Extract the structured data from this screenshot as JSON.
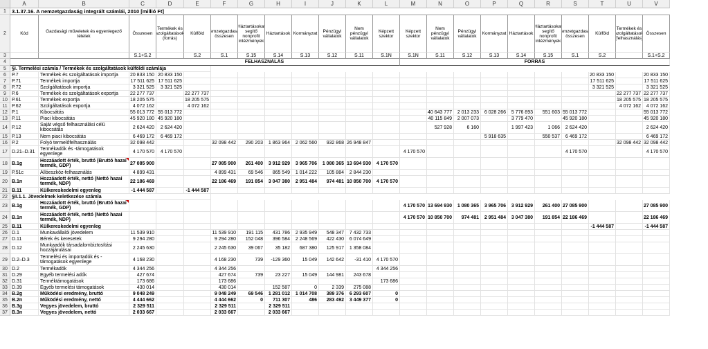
{
  "title": "3.1.37.16. A nemzetgazdaság integrált számlái, 2010 [millió Ft]",
  "columns": [
    "A",
    "B",
    "C",
    "D",
    "E",
    "F",
    "G",
    "H",
    "I",
    "J",
    "K",
    "L",
    "M",
    "N",
    "O",
    "P",
    "Q",
    "R",
    "S",
    "T",
    "U",
    "V"
  ],
  "header_row2": [
    "Kód",
    "Gazdasági műveletek és egyenlegező tételek",
    "Összesen",
    "Termékek és szolgáltatások (forrás)",
    "Külföld",
    "Nemzetgazdaság összesen",
    "Háztartásokat segítő nonprofit intézmények",
    "Háztartások",
    "Kormányzat",
    "Pénzügyi vállalatok",
    "Nem pénzügyi vállalatok",
    "Képzett szektor",
    "Képzett szektor",
    "Nem pénzügyi vállalatok",
    "Pénzügyi vállalatok",
    "Kormányzat",
    "Háztartások",
    "Háztartásokat segítő nonprofit intézmények",
    "Nemzetgazdaság összesen",
    "Külföld",
    "Termékek és szolgáltatások (felhasználás)",
    "Összesen"
  ],
  "header_row3": [
    "",
    "",
    "S.1+S.2",
    "",
    "S.2",
    "S.1",
    "S.15",
    "S.14",
    "S.13",
    "S.12",
    "S.11",
    "S.1N",
    "S.1N",
    "S.11",
    "S.12",
    "S.13",
    "S.14",
    "S.15",
    "S.1",
    "S.2",
    "",
    "S.1+S.2"
  ],
  "group_labels": {
    "use": "FELHASZNÁLÁS",
    "resource": "FORRÁS"
  },
  "rows": [
    {
      "n": "5",
      "sec": "§I. Termelési számla / Termékek és szolgáltatások külföldi számlája"
    },
    {
      "n": "6",
      "c": [
        "P.7",
        "Termékek és szolgáltatások importja",
        "20 833 150",
        "20 833 150",
        "",
        "",
        "",
        "",
        "",
        "",
        "",
        "",
        "",
        "",
        "",
        "",
        "",
        "",
        "",
        "20 833 150",
        "",
        "20 833 150"
      ]
    },
    {
      "n": "7",
      "c": [
        "P.71",
        "Termékek importja",
        "17 511 625",
        "17 511 625",
        "",
        "",
        "",
        "",
        "",
        "",
        "",
        "",
        "",
        "",
        "",
        "",
        "",
        "",
        "",
        "17 511 625",
        "",
        "17 511 625"
      ]
    },
    {
      "n": "8",
      "c": [
        "P.72",
        "Szolgáltatások importja",
        "3 321 525",
        "3 321 525",
        "",
        "",
        "",
        "",
        "",
        "",
        "",
        "",
        "",
        "",
        "",
        "",
        "",
        "",
        "",
        "3 321 525",
        "",
        "3 321 525"
      ]
    },
    {
      "n": "9",
      "c": [
        "P.6",
        "Termékek és szolgáltatások exportja",
        "22 277 737",
        "",
        "22 277 737",
        "",
        "",
        "",
        "",
        "",
        "",
        "",
        "",
        "",
        "",
        "",
        "",
        "",
        "",
        "",
        "22 277 737",
        "22 277 737"
      ]
    },
    {
      "n": "10",
      "c": [
        "P.61",
        "Termékek exportja",
        "18 205 575",
        "",
        "18 205 575",
        "",
        "",
        "",
        "",
        "",
        "",
        "",
        "",
        "",
        "",
        "",
        "",
        "",
        "",
        "",
        "18 205 575",
        "18 205 575"
      ]
    },
    {
      "n": "11",
      "c": [
        "P.62",
        "Szolgáltatások exportja",
        "4 072 162",
        "",
        "4 072 162",
        "",
        "",
        "",
        "",
        "",
        "",
        "",
        "",
        "",
        "",
        "",
        "",
        "",
        "",
        "",
        "4 072 162",
        "4 072 162"
      ]
    },
    {
      "n": "12",
      "c": [
        "P.1",
        "Kibocsátás",
        "55 013 772",
        "55 013 772",
        "",
        "",
        "",
        "",
        "",
        "",
        "",
        "",
        "",
        "40 643 777",
        "2 013 233",
        "6 028 266",
        "5 776 893",
        "551 603",
        "55 013 772",
        "",
        "",
        "55 013 772"
      ]
    },
    {
      "n": "13",
      "c": [
        "P.11",
        "Piaci kibocsátás",
        "45 920 180",
        "45 920 180",
        "",
        "",
        "",
        "",
        "",
        "",
        "",
        "",
        "",
        "40 115 849",
        "2 007 073",
        "",
        "3 779 470",
        "",
        "45 920 180",
        "",
        "",
        "45 920 180"
      ]
    },
    {
      "n": "14",
      "c": [
        "P.12",
        "Saját végső felhasználási célú kibocsátás",
        "2 624 420",
        "2 624 420",
        "",
        "",
        "",
        "",
        "",
        "",
        "",
        "",
        "",
        "527 928",
        "6 160",
        "",
        "1 997 423",
        "1 066",
        "2 624 420",
        "",
        "",
        "2 624 420"
      ]
    },
    {
      "n": "15",
      "c": [
        "P.13",
        "Nem piaci kibocsátás",
        "6 469 172",
        "6 469 172",
        "",
        "",
        "",
        "",
        "",
        "",
        "",
        "",
        "",
        "",
        "",
        "5 918 635",
        "",
        "550 537",
        "6 469 172",
        "",
        "",
        "6 469 172"
      ]
    },
    {
      "n": "16",
      "c": [
        "P.2",
        "Folyó termelőfelhasználás",
        "32 098 442",
        "",
        "",
        "32 098 442",
        "290 203",
        "1 863 964",
        "2 062 560",
        "932 868",
        "26 948 847",
        "",
        "",
        "",
        "",
        "",
        "",
        "",
        "",
        "",
        "32 098 442",
        "32 098 442"
      ]
    },
    {
      "n": "17",
      "c": [
        "D.21–D.31",
        "Termékadók és -támogatások egyenlege",
        "4 170 570",
        "4 170 570",
        "",
        "",
        "",
        "",
        "",
        "",
        "",
        "",
        "4 170 570",
        "",
        "",
        "",
        "",
        "",
        "4 170 570",
        "",
        "",
        "4 170 570"
      ]
    },
    {
      "n": "18",
      "b": 1,
      "c": [
        "B.1g",
        "Hozzáadott érték, bruttó (Bruttó hazai termék, GDP)",
        "27 085 900",
        "",
        "",
        "27 085 900",
        "261 400",
        "3 912 929",
        "3 965 706",
        "1 080 365",
        "13 694 930",
        "4 170 570",
        "",
        "",
        "",
        "",
        "",
        "",
        "",
        "",
        "",
        ""
      ]
    },
    {
      "n": "19",
      "c": [
        "P.51c",
        "Állóeszköz-felhasználás",
        "4 899 431",
        "",
        "",
        "4 899 431",
        "69 546",
        "865 549",
        "1 014 222",
        "105 884",
        "2 844 230",
        "",
        "",
        "",
        "",
        "",
        "",
        "",
        "",
        "",
        "",
        ""
      ]
    },
    {
      "n": "20",
      "b": 1,
      "c": [
        "B.1n",
        "Hozzáadott érték, nettó (Nettó hazai termék, NDP)",
        "22 186 469",
        "",
        "",
        "22 186 469",
        "191 854",
        "3 047 380",
        "2 951 484",
        "974 481",
        "10 850 700",
        "4 170 570",
        "",
        "",
        "",
        "",
        "",
        "",
        "",
        "",
        "",
        ""
      ]
    },
    {
      "n": "21",
      "b": 1,
      "c": [
        "B.11",
        "Külkereskedelmi egyenleg",
        "-1 444 587",
        "",
        "-1 444 587",
        "",
        "",
        "",
        "",
        "",
        "",
        "",
        "",
        "",
        "",
        "",
        "",
        "",
        "",
        "",
        "",
        ""
      ]
    },
    {
      "n": "22",
      "sec": "§II.1.1. Jövedelmek keletkezése számla"
    },
    {
      "n": "23",
      "b": 1,
      "c": [
        "B.1g",
        "Hozzáadott érték, bruttó (Bruttó hazai termék, GDP)",
        "",
        "",
        "",
        "",
        "",
        "",
        "",
        "",
        "",
        "",
        "4 170 570",
        "13 694 930",
        "1 080 365",
        "3 965 706",
        "3 912 929",
        "261 400",
        "27 085 900",
        "",
        "",
        "27 085 900"
      ]
    },
    {
      "n": "24",
      "b": 1,
      "c": [
        "B.1n",
        "Hozzáadott érték, nettó (Nettó hazai termék, NDP)",
        "",
        "",
        "",
        "",
        "",
        "",
        "",
        "",
        "",
        "",
        "4 170 570",
        "10 850 700",
        "974 481",
        "2 951 484",
        "3 047 380",
        "191 854",
        "22 186 469",
        "",
        "",
        "22 186 469"
      ]
    },
    {
      "n": "25",
      "b": 1,
      "c": [
        "B.11",
        "Külkereskedelmi egyenleg",
        "",
        "",
        "",
        "",
        "",
        "",
        "",
        "",
        "",
        "",
        "",
        "",
        "",
        "",
        "",
        "",
        "",
        "-1 444 587",
        "",
        "-1 444 587"
      ]
    },
    {
      "n": "26",
      "c": [
        "D.1",
        "Munkavállalói jövedelem",
        "11 539 910",
        "",
        "",
        "11 539 910",
        "191 115",
        "431 786",
        "2 935 949",
        "548 347",
        "7 432 733",
        "",
        "",
        "",
        "",
        "",
        "",
        "",
        "",
        "",
        "",
        ""
      ]
    },
    {
      "n": "27",
      "c": [
        "D.11",
        "Bérek és keresetek",
        "9 294 280",
        "",
        "",
        "9 294 280",
        "152 048",
        "396 584",
        "2 248 569",
        "422 430",
        "6 074 649",
        "",
        "",
        "",
        "",
        "",
        "",
        "",
        "",
        "",
        "",
        ""
      ]
    },
    {
      "n": "28",
      "c": [
        "D.12",
        "Munkaadók társadalombiztosítási hozzájárulásai",
        "2 245 630",
        "",
        "",
        "2 245 630",
        "39 067",
        "35 182",
        "687 380",
        "125 917",
        "1 358 084",
        "",
        "",
        "",
        "",
        "",
        "",
        "",
        "",
        "",
        "",
        ""
      ]
    },
    {
      "n": "29",
      "c": [
        "D.2–D.3",
        "Termelési és importadók és -támogatások egyenlege",
        "4 168 230",
        "",
        "",
        "4 168 230",
        "739",
        "-129 360",
        "15 049",
        "142 642",
        "-31 410",
        "4 170 570",
        "",
        "",
        "",
        "",
        "",
        "",
        "",
        "",
        "",
        ""
      ]
    },
    {
      "n": "30",
      "c": [
        "D.2",
        "Termékadók",
        "4 344 256",
        "",
        "",
        "4 344 256",
        "",
        "",
        "",
        "",
        "",
        "4 344 256",
        "",
        "",
        "",
        "",
        "",
        "",
        "",
        "",
        "",
        ""
      ]
    },
    {
      "n": "31",
      "c": [
        "D.29",
        "Egyéb termelési adók",
        "427 674",
        "",
        "",
        "427 674",
        "739",
        "23 227",
        "15 049",
        "144 981",
        "243 678",
        "",
        "",
        "",
        "",
        "",
        "",
        "",
        "",
        "",
        "",
        ""
      ]
    },
    {
      "n": "32",
      "c": [
        "D.31",
        "Terméktámogatások",
        "173 686",
        "",
        "",
        "173 686",
        "",
        "",
        "",
        "",
        "",
        "173 686",
        "",
        "",
        "",
        "",
        "",
        "",
        "",
        "",
        "",
        ""
      ]
    },
    {
      "n": "33",
      "c": [
        "D.39",
        "Egyéb termelési támogatások",
        "430 014",
        "",
        "",
        "430 014",
        "",
        "152 587",
        "0",
        "2 339",
        "275 088",
        "",
        "",
        "",
        "",
        "",
        "",
        "",
        "",
        "",
        "",
        ""
      ]
    },
    {
      "n": "34",
      "b": 1,
      "c": [
        "B.2g",
        "Működési eredmény, bruttó",
        "9 048 249",
        "",
        "",
        "9 048 249",
        "69 546",
        "1 281 012",
        "1 014 708",
        "389 376",
        "6 293 607",
        "0",
        "",
        "",
        "",
        "",
        "",
        "",
        "",
        "",
        "",
        ""
      ]
    },
    {
      "n": "35",
      "b": 1,
      "c": [
        "B.2n",
        "Működési eredmény, nettó",
        "4 444 662",
        "",
        "",
        "4 444 662",
        "0",
        "711 307",
        "486",
        "283 492",
        "3 449 377",
        "0",
        "",
        "",
        "",
        "",
        "",
        "",
        "",
        "",
        "",
        ""
      ]
    },
    {
      "n": "36",
      "b": 1,
      "c": [
        "B.3g",
        "Vegyes jövedelem, bruttó",
        "2 329 511",
        "",
        "",
        "2 329 511",
        "",
        "2 329 511",
        "",
        "",
        "",
        "",
        "",
        "",
        "",
        "",
        "",
        "",
        "",
        "",
        "",
        ""
      ]
    },
    {
      "n": "37",
      "b": 1,
      "c": [
        "B.3n",
        "Vegyes jövedelem, nettó",
        "2 033 667",
        "",
        "",
        "2 033 667",
        "",
        "2 033 667",
        "",
        "",
        "",
        "",
        "",
        "",
        "",
        "",
        "",
        "",
        "",
        "",
        "",
        ""
      ]
    }
  ]
}
